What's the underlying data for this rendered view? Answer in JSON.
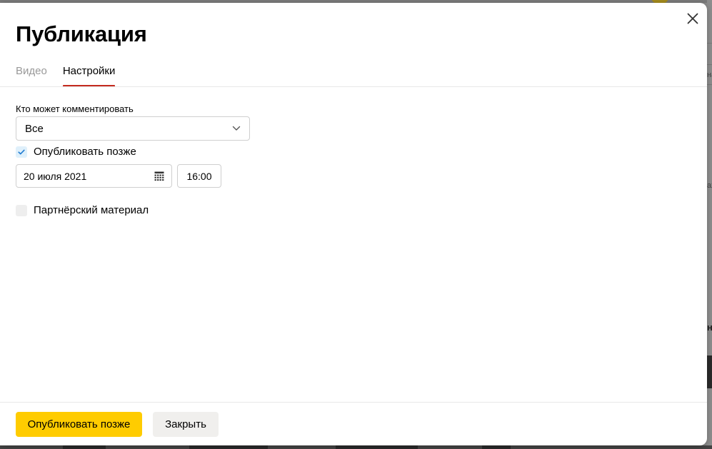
{
  "modal": {
    "title": "Публикация",
    "tabs": [
      {
        "label": "Видео",
        "active": false
      },
      {
        "label": "Настройки",
        "active": true
      }
    ],
    "comments": {
      "label": "Кто может комментировать",
      "selected_value": "Все"
    },
    "publish_later": {
      "label": "Опубликовать позже",
      "checked": true,
      "date": "20 июля 2021",
      "time": "16:00"
    },
    "partner_material": {
      "label": "Партнёрский материал",
      "checked": false
    },
    "footer": {
      "primary_button": "Опубликовать позже",
      "secondary_button": "Закрыть"
    }
  },
  "background": {
    "right_text_1": "на",
    "right_text_2": "ах",
    "right_text_3": "не"
  },
  "colors": {
    "primary_button": "#ffcc00",
    "secondary_button": "#f0efed",
    "active_tab_underline": "#c42a1e",
    "checkbox_checked_bg": "#dff0fb",
    "checkmark": "#1f7bd1"
  }
}
